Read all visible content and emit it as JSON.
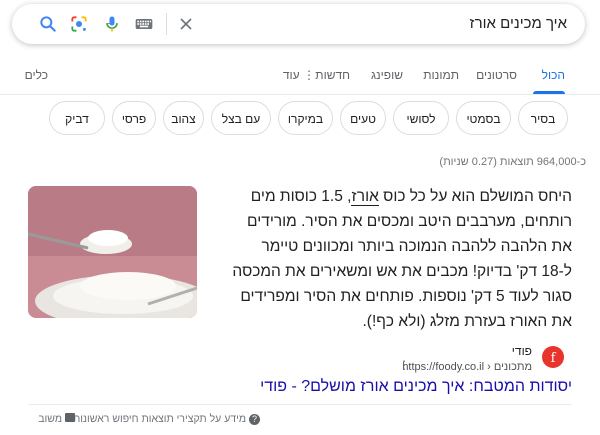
{
  "search": {
    "query": "איך מכינים אורז"
  },
  "tabs": [
    {
      "label": "הכול"
    },
    {
      "label": "סרטונים"
    },
    {
      "label": "תמונות"
    },
    {
      "label": "שופינג"
    },
    {
      "label": "חדשות"
    },
    {
      "label": "עוד"
    },
    {
      "label": "כלים"
    }
  ],
  "chips": [
    "בסיר",
    "בסמטי",
    "לסושי",
    "טעים",
    "במיקרו",
    "עם בצל",
    "צהוב",
    "פרסי",
    "דביק"
  ],
  "stats": "כ-964,000 תוצאות (0.27 שניות)",
  "snippet": {
    "part1": "היחס המושלם הוא על כל כוס ",
    "highlight": "אורז",
    "part2": ", 1.5 כוסות מים רותחים, מערבבים היטב ומכסים את הסיר. מורידים את הלהבה ללהבה הנמוכה ביותר ומכוונים טיימר ל-18 דק' בדיוק! מכבים את אש ומשאירים את המכסה סגור לעוד 5 דק' נוספות. פותחים את הסיר ומפרידים את האורז בעזרת מזלג (ולא כף!)."
  },
  "source": {
    "name": "פודי",
    "url": "https://foody.co.il › מתכונים",
    "more_icon": "more-vert-icon"
  },
  "result_title": "יסודות המטבח: איך מכינים אורז מושלם? - פודי",
  "footer": {
    "about": "מידע על תקצירי תוצאות חיפוש ראשונות",
    "feedback": "משוב"
  },
  "colors": {
    "accent": "#1a73e8",
    "link": "#1a0dab",
    "logo": "#e8342b"
  }
}
